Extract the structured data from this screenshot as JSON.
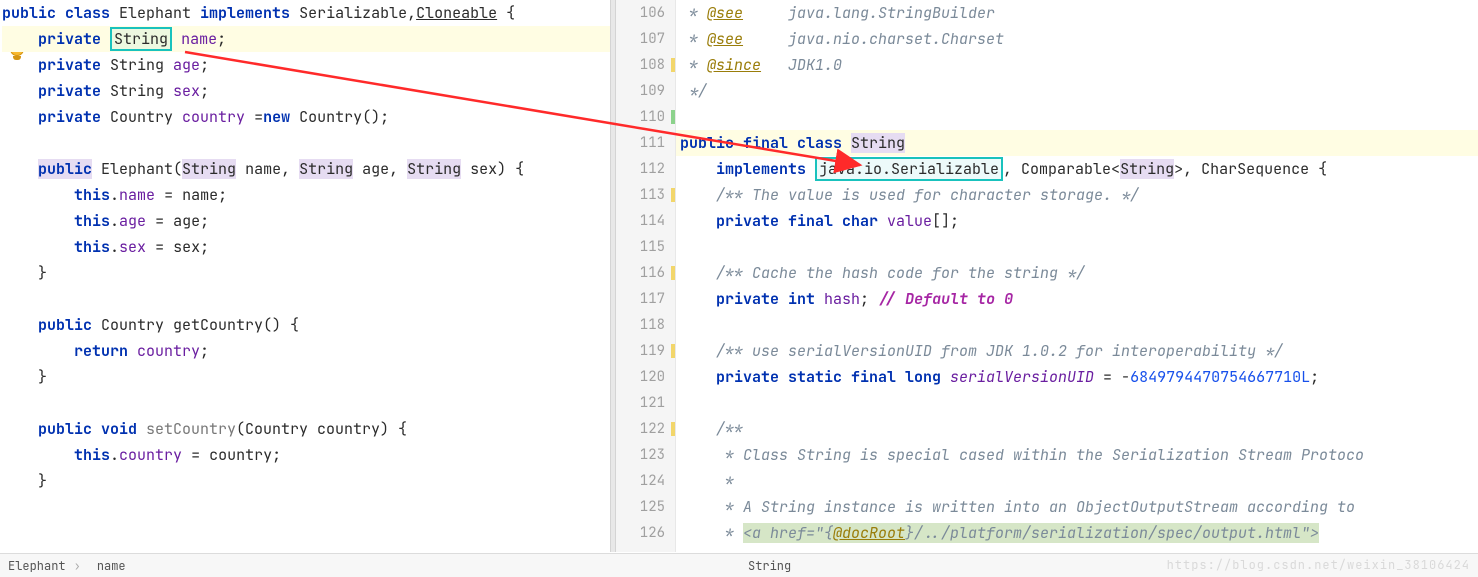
{
  "left": {
    "lines": [
      {
        "n": "",
        "tokens": [
          {
            "t": "public ",
            "c": "kw"
          },
          {
            "t": "class ",
            "c": "kw"
          },
          {
            "t": "Elephant ",
            "c": ""
          },
          {
            "t": "implements ",
            "c": "kw"
          },
          {
            "t": "Serializable",
            "c": ""
          },
          {
            "t": ",",
            "c": ""
          },
          {
            "t": "Cloneable",
            "c": "under"
          },
          {
            "t": " {",
            "c": ""
          }
        ]
      },
      {
        "n": "",
        "hl": true,
        "tokens": [
          {
            "t": "    ",
            "c": ""
          },
          {
            "t": "private",
            "c": "kw"
          },
          {
            "t": " ",
            "c": ""
          },
          {
            "t": "String",
            "c": "boxed"
          },
          {
            "t": " ",
            "c": ""
          },
          {
            "t": "name",
            "c": "field"
          },
          {
            "t": ";",
            "c": ""
          }
        ]
      },
      {
        "n": "",
        "tokens": [
          {
            "t": "    ",
            "c": ""
          },
          {
            "t": "private ",
            "c": "kw"
          },
          {
            "t": "String ",
            "c": ""
          },
          {
            "t": "age",
            "c": "field"
          },
          {
            "t": ";",
            "c": ""
          }
        ]
      },
      {
        "n": "",
        "tokens": [
          {
            "t": "    ",
            "c": ""
          },
          {
            "t": "private ",
            "c": "kw"
          },
          {
            "t": "String ",
            "c": ""
          },
          {
            "t": "sex",
            "c": "field"
          },
          {
            "t": ";",
            "c": ""
          }
        ]
      },
      {
        "n": "",
        "tokens": [
          {
            "t": "    ",
            "c": ""
          },
          {
            "t": "private ",
            "c": "kw"
          },
          {
            "t": "Country ",
            "c": ""
          },
          {
            "t": "country",
            "c": "field"
          },
          {
            "t": " =",
            "c": ""
          },
          {
            "t": "new ",
            "c": "kw"
          },
          {
            "t": "Country();",
            "c": ""
          }
        ]
      },
      {
        "n": "",
        "tokens": [
          {
            "t": " ",
            "c": ""
          }
        ]
      },
      {
        "n": "",
        "tokens": [
          {
            "t": "    ",
            "c": ""
          },
          {
            "t": "public",
            "c": "kw bg-usage"
          },
          {
            "t": " Elephant(",
            "c": ""
          },
          {
            "t": "String",
            "c": "bg-usage"
          },
          {
            "t": " name, ",
            "c": ""
          },
          {
            "t": "String",
            "c": "bg-usage"
          },
          {
            "t": " age, ",
            "c": ""
          },
          {
            "t": "String",
            "c": "bg-usage"
          },
          {
            "t": " sex) {",
            "c": ""
          }
        ]
      },
      {
        "n": "",
        "tokens": [
          {
            "t": "        ",
            "c": ""
          },
          {
            "t": "this",
            "c": "kw"
          },
          {
            "t": ".",
            "c": ""
          },
          {
            "t": "name",
            "c": "field"
          },
          {
            "t": " = name;",
            "c": ""
          }
        ]
      },
      {
        "n": "",
        "tokens": [
          {
            "t": "        ",
            "c": ""
          },
          {
            "t": "this",
            "c": "kw"
          },
          {
            "t": ".",
            "c": ""
          },
          {
            "t": "age",
            "c": "field"
          },
          {
            "t": " = age;",
            "c": ""
          }
        ]
      },
      {
        "n": "",
        "tokens": [
          {
            "t": "        ",
            "c": ""
          },
          {
            "t": "this",
            "c": "kw"
          },
          {
            "t": ".",
            "c": ""
          },
          {
            "t": "sex",
            "c": "field"
          },
          {
            "t": " = sex;",
            "c": ""
          }
        ]
      },
      {
        "n": "",
        "tokens": [
          {
            "t": "    }",
            "c": ""
          }
        ]
      },
      {
        "n": "",
        "tokens": [
          {
            "t": " ",
            "c": ""
          }
        ]
      },
      {
        "n": "",
        "tokens": [
          {
            "t": "    ",
            "c": ""
          },
          {
            "t": "public ",
            "c": "kw"
          },
          {
            "t": "Country getCountry() {",
            "c": ""
          }
        ]
      },
      {
        "n": "",
        "tokens": [
          {
            "t": "        ",
            "c": ""
          },
          {
            "t": "return ",
            "c": "kw"
          },
          {
            "t": "country",
            "c": "field"
          },
          {
            "t": ";",
            "c": ""
          }
        ]
      },
      {
        "n": "",
        "tokens": [
          {
            "t": "    }",
            "c": ""
          }
        ]
      },
      {
        "n": "",
        "tokens": [
          {
            "t": " ",
            "c": ""
          }
        ]
      },
      {
        "n": "",
        "tokens": [
          {
            "t": "    ",
            "c": ""
          },
          {
            "t": "public void ",
            "c": "kw"
          },
          {
            "t": "setCountry",
            "c": "faded"
          },
          {
            "t": "(Country country) {",
            "c": ""
          }
        ]
      },
      {
        "n": "",
        "tokens": [
          {
            "t": "        ",
            "c": ""
          },
          {
            "t": "this",
            "c": "kw"
          },
          {
            "t": ".",
            "c": ""
          },
          {
            "t": "country",
            "c": "field"
          },
          {
            "t": " = country;",
            "c": ""
          }
        ]
      },
      {
        "n": "",
        "tokens": [
          {
            "t": "    }",
            "c": ""
          }
        ]
      }
    ]
  },
  "right": {
    "start": 106,
    "marks": {
      "108": "y",
      "110": "g",
      "113": "y",
      "116": "y",
      "119": "y",
      "122": "y"
    },
    "lines": [
      {
        "tokens": [
          {
            "t": " * ",
            "c": "jdoc"
          },
          {
            "t": "@see",
            "c": "ann"
          },
          {
            "t": "     java.lang.StringBuilder",
            "c": "jdoc ital"
          }
        ]
      },
      {
        "tokens": [
          {
            "t": " * ",
            "c": "jdoc"
          },
          {
            "t": "@see",
            "c": "ann"
          },
          {
            "t": "     java.nio.charset.Charset",
            "c": "jdoc ital"
          }
        ]
      },
      {
        "tokens": [
          {
            "t": " * ",
            "c": "jdoc"
          },
          {
            "t": "@since",
            "c": "ann"
          },
          {
            "t": "   JDK1.0",
            "c": "jdoc ital"
          }
        ]
      },
      {
        "tokens": [
          {
            "t": " */",
            "c": "jdoc"
          }
        ]
      },
      {
        "tokens": [
          {
            "t": " ",
            "c": ""
          }
        ]
      },
      {
        "hl": true,
        "tokens": [
          {
            "t": "public final class ",
            "c": "kw"
          },
          {
            "t": "String",
            "c": "bg-usage"
          }
        ]
      },
      {
        "tokens": [
          {
            "t": "    ",
            "c": ""
          },
          {
            "t": "implements ",
            "c": "kw"
          },
          {
            "t": "java.io.Serializable",
            "c": "boxed"
          },
          {
            "t": ", Comparable<",
            "c": ""
          },
          {
            "t": "String",
            "c": "bg-usage"
          },
          {
            "t": ">, CharSequence {",
            "c": ""
          }
        ]
      },
      {
        "tokens": [
          {
            "t": "    ",
            "c": ""
          },
          {
            "t": "/** The value is used for character storage. */",
            "c": "jdoc"
          }
        ]
      },
      {
        "tokens": [
          {
            "t": "    ",
            "c": ""
          },
          {
            "t": "private final char ",
            "c": "kw"
          },
          {
            "t": "value",
            "c": "field"
          },
          {
            "t": "[];",
            "c": ""
          }
        ]
      },
      {
        "tokens": [
          {
            "t": " ",
            "c": ""
          }
        ]
      },
      {
        "tokens": [
          {
            "t": "    ",
            "c": ""
          },
          {
            "t": "/** Cache the hash code for the string */",
            "c": "jdoc"
          }
        ]
      },
      {
        "tokens": [
          {
            "t": "    ",
            "c": ""
          },
          {
            "t": "private int ",
            "c": "kw"
          },
          {
            "t": "hash",
            "c": "field"
          },
          {
            "t": "; ",
            "c": ""
          },
          {
            "t": "// Default to 0",
            "c": "purple"
          }
        ]
      },
      {
        "tokens": [
          {
            "t": " ",
            "c": ""
          }
        ]
      },
      {
        "tokens": [
          {
            "t": "    ",
            "c": ""
          },
          {
            "t": "/** use serialVersionUID from JDK 1.0.2 for interoperability */",
            "c": "jdoc"
          }
        ]
      },
      {
        "tokens": [
          {
            "t": "    ",
            "c": ""
          },
          {
            "t": "private static final long ",
            "c": "kw"
          },
          {
            "t": "serialVersionUID",
            "c": "field ital"
          },
          {
            "t": " = -",
            "c": ""
          },
          {
            "t": "6849794470754667710L",
            "c": "num-lit"
          },
          {
            "t": ";",
            "c": ""
          }
        ]
      },
      {
        "tokens": [
          {
            "t": " ",
            "c": ""
          }
        ]
      },
      {
        "tokens": [
          {
            "t": "    ",
            "c": ""
          },
          {
            "t": "/**",
            "c": "jdoc"
          }
        ]
      },
      {
        "tokens": [
          {
            "t": "     * Class String is special cased within the Serialization Stream Protoco",
            "c": "jdoc"
          }
        ]
      },
      {
        "tokens": [
          {
            "t": "     *",
            "c": "jdoc"
          }
        ]
      },
      {
        "tokens": [
          {
            "t": "     * A String instance is written into an ObjectOutputStream according to",
            "c": "jdoc"
          }
        ]
      },
      {
        "tokens": [
          {
            "t": "     * ",
            "c": "jdoc"
          },
          {
            "t": "<a href=\"{",
            "c": "jdoc bg-link"
          },
          {
            "t": "@docRoot",
            "c": "ann bg-link"
          },
          {
            "t": "}/../platform/serialization/spec/output.html\">",
            "c": "jdoc bg-link"
          }
        ]
      }
    ]
  },
  "breadcrumb_left": [
    "Elephant",
    "name"
  ],
  "breadcrumb_right": "String",
  "watermark": "https://blog.csdn.net/weixin_38106424"
}
